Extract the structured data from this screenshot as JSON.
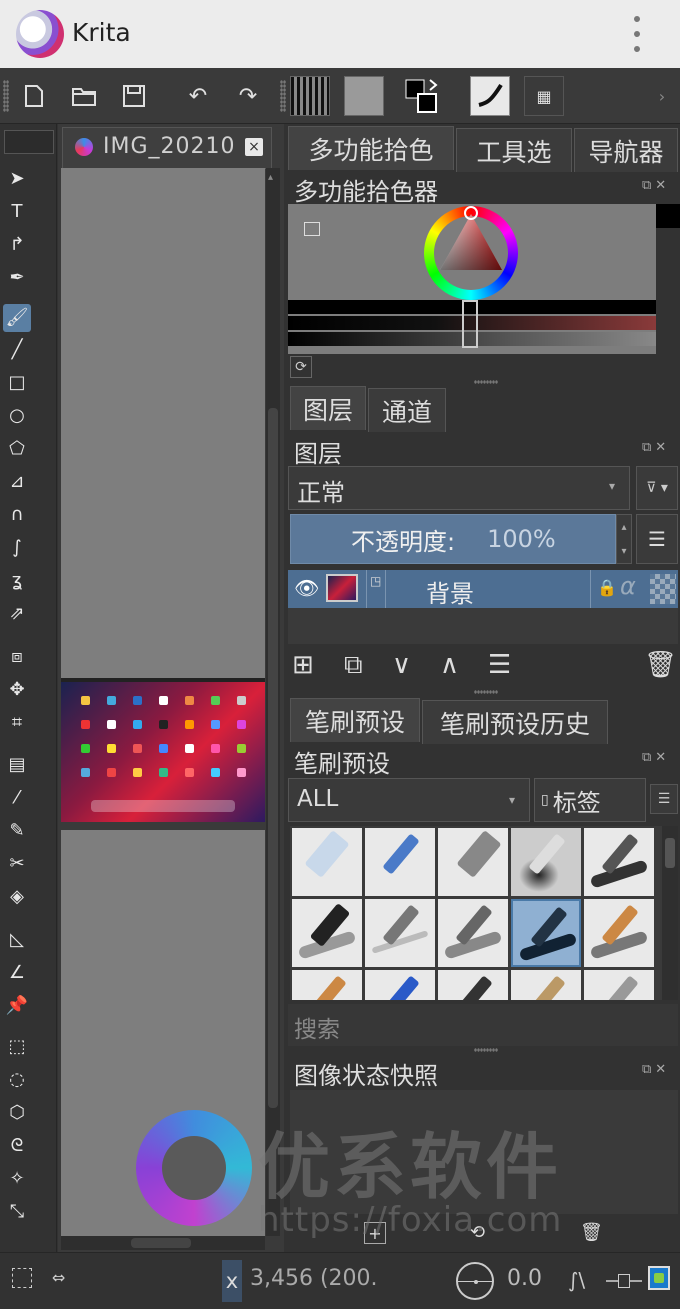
{
  "app": {
    "title": "Krita"
  },
  "document": {
    "tab_label": "IMG_20210",
    "close_label": "×"
  },
  "right_panel": {
    "dock_tabs": [
      "多功能拾色",
      "工具选",
      "导航器"
    ],
    "color_selector_title": "多功能拾色器",
    "layer_tabs": [
      "图层",
      "通道"
    ],
    "layers_title": "图层",
    "blend_mode": "正常",
    "opacity_label": "不透明度:",
    "opacity_value": "100%",
    "layer_name": "背景",
    "brush_tabs": [
      "笔刷预设",
      "笔刷预设历史"
    ],
    "brush_title": "笔刷预设",
    "brush_filter": "ALL",
    "tag_label": "标签",
    "search_placeholder": "搜索",
    "snapshot_title": "图像状态快照",
    "alpha_label": "α"
  },
  "statusbar": {
    "x_label": "x",
    "x_value": "3,456  (200.",
    "rotation_value": "0.0"
  },
  "watermark": {
    "text": "优系软件",
    "url": "https://foxia.com"
  },
  "colors": {
    "accent": "#5b7899",
    "selected_layer": "#4d6e92",
    "titlebar": "#ececec"
  },
  "icons": {
    "toolbar": [
      "new-document-icon",
      "open-folder-icon",
      "save-icon",
      "undo-icon",
      "redo-icon",
      "gradient-icon",
      "pattern-icon",
      "color-swap-icon",
      "brush-preset-icon",
      "workspace-icon"
    ],
    "tools": [
      "select-shape-icon",
      "text-icon",
      "edit-shape-icon",
      "calligraphy-icon",
      "freehand-brush-icon",
      "line-icon",
      "rectangle-icon",
      "ellipse-icon",
      "polygon-icon",
      "polyline-icon",
      "bezier-icon",
      "freehand-path-icon",
      "dynamic-brush-icon",
      "multibrush-icon",
      "transform-icon",
      "move-icon",
      "crop-icon",
      "gradient-tool-icon",
      "color-picker-icon",
      "colorize-mask-icon",
      "smart-patch-icon",
      "fill-icon",
      "assistant-icon",
      "measure-icon",
      "reference-icon",
      "rect-select-icon",
      "ellipse-select-icon",
      "polygon-select-icon",
      "freehand-select-icon",
      "magic-wand-icon",
      "bezier-select-icon"
    ]
  }
}
